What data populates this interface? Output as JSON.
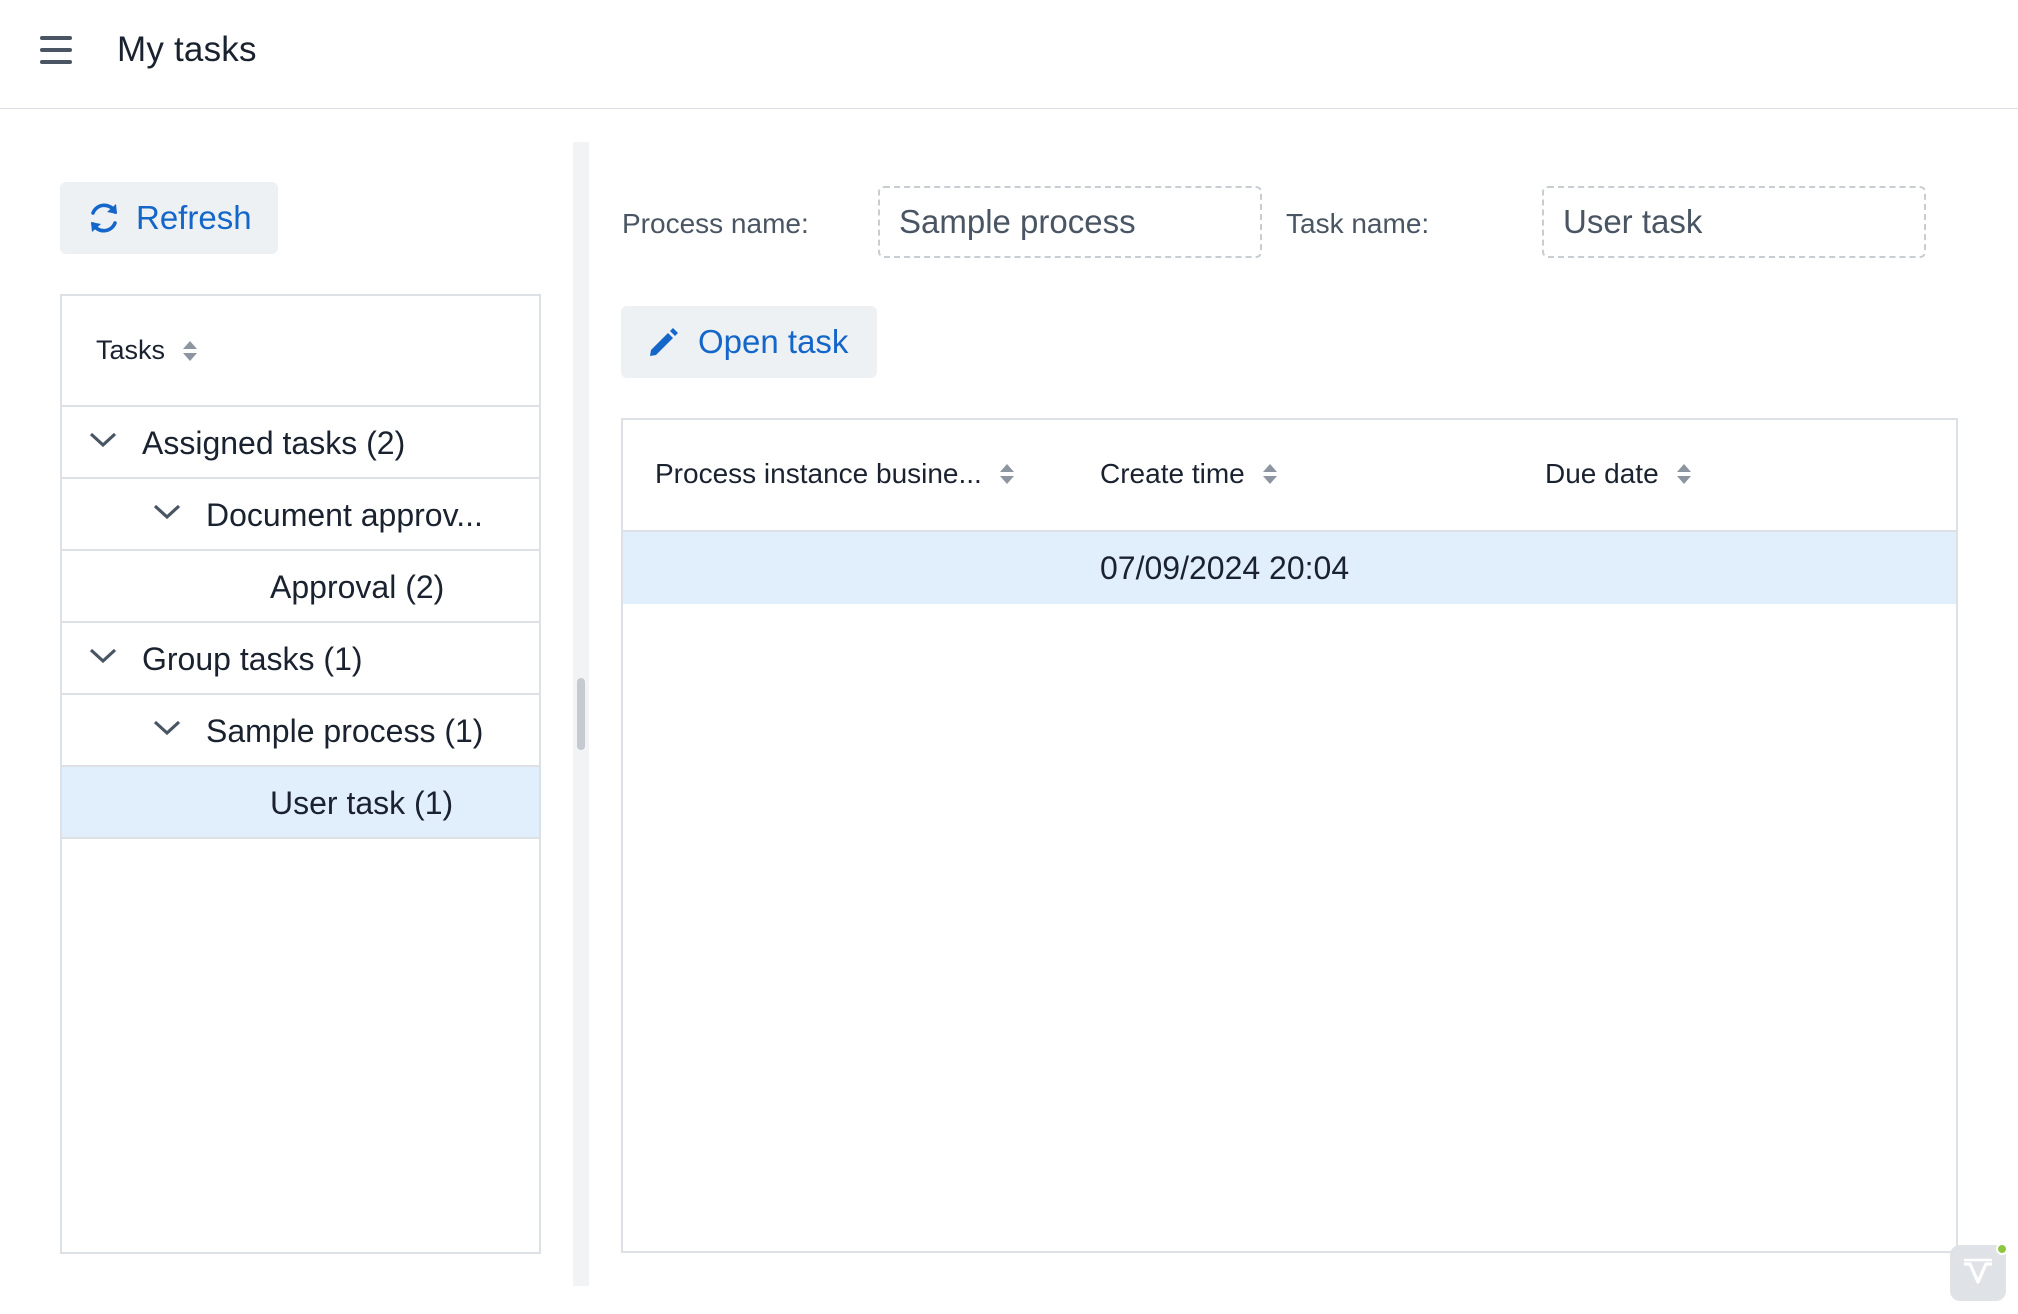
{
  "header": {
    "title": "My tasks",
    "menu_icon": "hamburger-menu-icon"
  },
  "left": {
    "refresh_label": "Refresh",
    "tree": {
      "column_header": "Tasks",
      "items": [
        {
          "label": "Assigned tasks (2)",
          "level": 0,
          "expanded": true,
          "selected": false
        },
        {
          "label": "Document approv...",
          "level": 1,
          "expanded": true,
          "selected": false
        },
        {
          "label": "Approval (2)",
          "level": 2,
          "expanded": null,
          "selected": false
        },
        {
          "label": "Group tasks (1)",
          "level": 0,
          "expanded": true,
          "selected": false
        },
        {
          "label": "Sample process (1)",
          "level": 1,
          "expanded": true,
          "selected": false
        },
        {
          "label": "User task (1)",
          "level": 2,
          "expanded": null,
          "selected": true
        }
      ]
    }
  },
  "filters": {
    "process_name_label": "Process name:",
    "process_name_value": "Sample process",
    "task_name_label": "Task name:",
    "task_name_value": "User task"
  },
  "actions": {
    "open_task_label": "Open task"
  },
  "grid": {
    "columns": [
      "Process instance busine...",
      "Create time",
      "Due date"
    ],
    "rows": [
      {
        "business_key": "",
        "create_time": "07/09/2024 20:04",
        "due_date": "",
        "selected": true
      }
    ]
  },
  "colors": {
    "accent": "#1466c8",
    "selection": "#e1eefc",
    "border": "#dde1e6",
    "button_bg": "#eef1f4"
  }
}
